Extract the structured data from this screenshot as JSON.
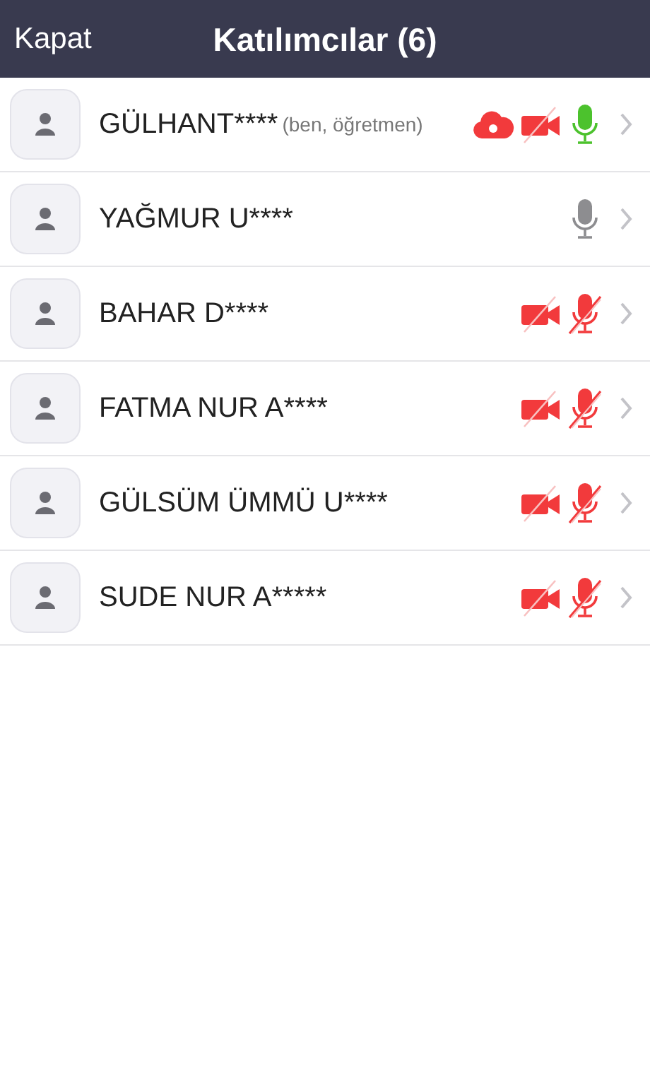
{
  "header": {
    "close_label": "Kapat",
    "title": "Katılımcılar (6)"
  },
  "participants": [
    {
      "name": "GÜLHANT****",
      "note": "(ben, öğretmen)",
      "cloud_recording": true,
      "video_off": true,
      "mic_muted": false,
      "speaking": true
    },
    {
      "name": "YAĞMUR U****",
      "cloud_recording": false,
      "video_off": false,
      "mic_muted": false,
      "speaking": false
    },
    {
      "name": "BAHAR D****",
      "cloud_recording": false,
      "video_off": true,
      "mic_muted": true
    },
    {
      "name": "FATMA NUR A****",
      "cloud_recording": false,
      "video_off": true,
      "mic_muted": true
    },
    {
      "name": "GÜLSÜM ÜMMÜ U****",
      "cloud_recording": false,
      "video_off": true,
      "mic_muted": true
    },
    {
      "name": "SUDE NUR A*****",
      "cloud_recording": false,
      "video_off": true,
      "mic_muted": true
    }
  ]
}
